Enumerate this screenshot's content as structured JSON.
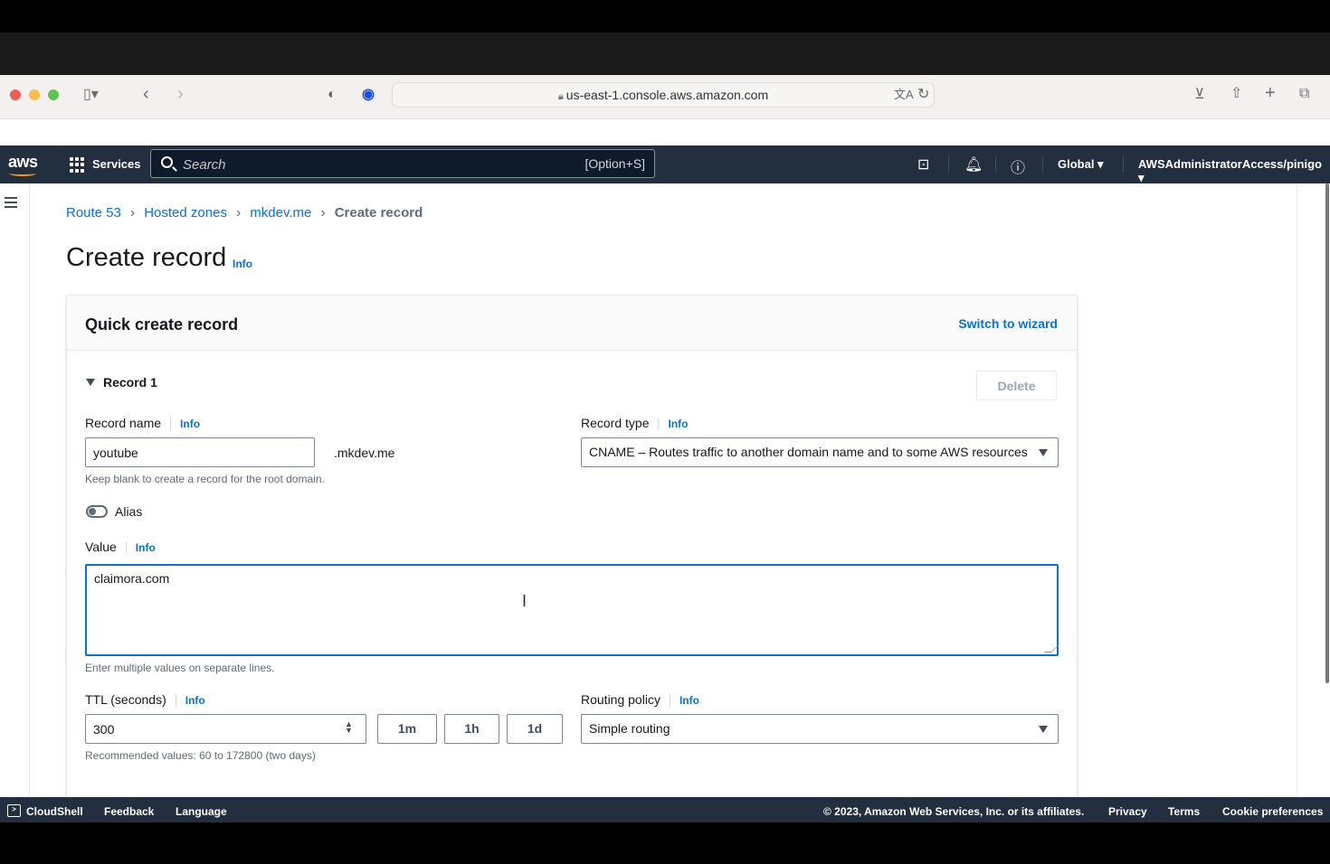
{
  "browser": {
    "url": "us-east-1.console.aws.amazon.com"
  },
  "nav": {
    "logo": "aws",
    "services": "Services",
    "search_placeholder": "Search",
    "search_shortcut": "[Option+S]",
    "region": "Global ▾",
    "account": "AWSAdministratorAccess/pinigo ▾"
  },
  "breadcrumb": {
    "items": [
      "Route 53",
      "Hosted zones",
      "mkdev.me"
    ],
    "current": "Create record"
  },
  "page": {
    "title": "Create record",
    "info": "Info"
  },
  "card": {
    "title": "Quick create record",
    "switch_label": "Switch to wizard",
    "record_title": "Record 1",
    "delete_label": "Delete"
  },
  "form": {
    "record_name": {
      "label": "Record name",
      "info": "Info",
      "value": "youtube",
      "suffix": ".mkdev.me",
      "hint": "Keep blank to create a record for the root domain."
    },
    "record_type": {
      "label": "Record type",
      "info": "Info",
      "value": "CNAME – Routes traffic to another domain name and to some AWS resources"
    },
    "alias": {
      "label": "Alias",
      "enabled": false
    },
    "value": {
      "label": "Value",
      "info": "Info",
      "text": "claimora.com",
      "hint": "Enter multiple values on separate lines."
    },
    "ttl": {
      "label": "TTL (seconds)",
      "info": "Info",
      "value": "300",
      "hint": "Recommended values: 60 to 172800 (two days)",
      "presets": [
        "1m",
        "1h",
        "1d"
      ]
    },
    "routing_policy": {
      "label": "Routing policy",
      "info": "Info",
      "value": "Simple routing"
    }
  },
  "footer": {
    "cloudshell": "CloudShell",
    "feedback": "Feedback",
    "language": "Language",
    "copyright": "© 2023, Amazon Web Services, Inc. or its affiliates.",
    "privacy": "Privacy",
    "terms": "Terms",
    "cookies": "Cookie preferences"
  }
}
